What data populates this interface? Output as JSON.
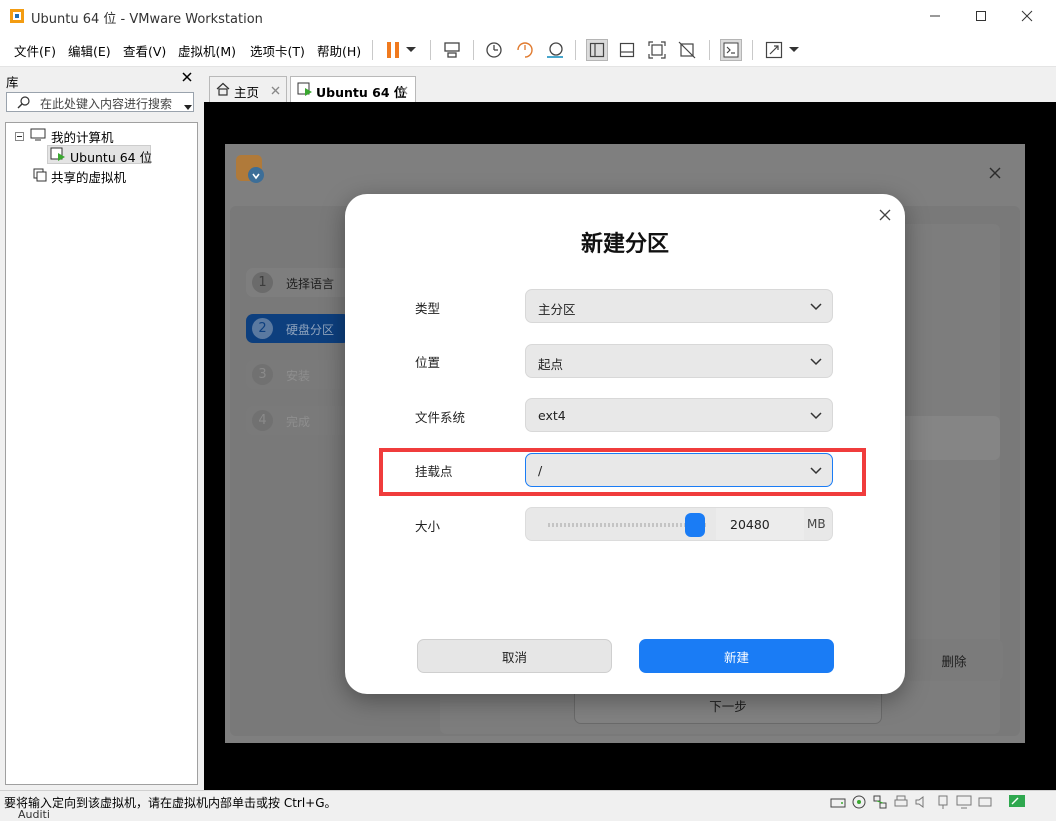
{
  "window": {
    "title": "Ubuntu 64 位 - VMware Workstation"
  },
  "menu": [
    "文件(F)",
    "编辑(E)",
    "查看(V)",
    "虚拟机(M)",
    "选项卡(T)",
    "帮助(H)"
  ],
  "library": {
    "title": "库",
    "search_placeholder": "在此处键入内容进行搜索",
    "tree": {
      "my_computer": "我的计算机",
      "vm": "Ubuntu 64 位",
      "shared": "共享的虚拟机"
    }
  },
  "tabs": [
    {
      "label": "主页"
    },
    {
      "label": "Ubuntu 64 位"
    }
  ],
  "installer": {
    "steps": [
      {
        "num": "1",
        "label": "选择语言"
      },
      {
        "num": "2",
        "label": "硬盘分区"
      },
      {
        "num": "3",
        "label": "安装"
      },
      {
        "num": "4",
        "label": "完成"
      }
    ],
    "delete_label": "删除",
    "next_label": "下一步"
  },
  "dialog": {
    "title": "新建分区",
    "fields": {
      "type": {
        "label": "类型",
        "value": "主分区"
      },
      "position": {
        "label": "位置",
        "value": "起点"
      },
      "filesystem": {
        "label": "文件系统",
        "value": "ext4"
      },
      "mount": {
        "label": "挂载点",
        "value": "/"
      },
      "size": {
        "label": "大小",
        "value": "20480",
        "unit": "MB",
        "slider_fraction": 0.92
      }
    },
    "cancel_label": "取消",
    "create_label": "新建"
  },
  "colors": {
    "accent": "#1a7cf5",
    "highlight": "#f03c3c"
  },
  "statusbar": {
    "message": "要将输入定向到该虚拟机，请在虚拟机内部单击或按 Ctrl+G。",
    "bottom_text": "Auditi"
  }
}
